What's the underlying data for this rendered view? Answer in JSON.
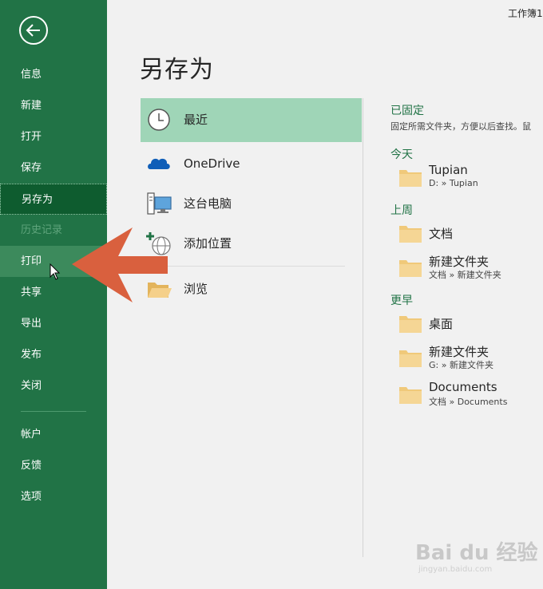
{
  "window": {
    "title": "工作簿1"
  },
  "sidebar": {
    "items": [
      {
        "label": "信息"
      },
      {
        "label": "新建"
      },
      {
        "label": "打开"
      },
      {
        "label": "保存"
      },
      {
        "label": "另存为"
      },
      {
        "label": "历史记录"
      },
      {
        "label": "打印"
      },
      {
        "label": "共享"
      },
      {
        "label": "导出"
      },
      {
        "label": "发布"
      },
      {
        "label": "关闭"
      },
      {
        "label": "帐户"
      },
      {
        "label": "反馈"
      },
      {
        "label": "选项"
      }
    ],
    "active": "另存为",
    "hovered": "打印",
    "disabled": "历史记录"
  },
  "main": {
    "title": "另存为",
    "locations": [
      {
        "label": "最近",
        "icon": "clock-icon"
      },
      {
        "label": "OneDrive",
        "icon": "cloud-icon"
      },
      {
        "label": "这台电脑",
        "icon": "computer-icon"
      },
      {
        "label": "添加位置",
        "icon": "add-globe-icon"
      },
      {
        "label": "浏览",
        "icon": "open-folder-icon"
      }
    ]
  },
  "recent": {
    "pinned": {
      "heading": "已固定",
      "description": "固定所需文件夹，方便以后查找。鼠"
    },
    "groups": [
      {
        "heading": "今天",
        "folders": [
          {
            "name": "Tupian",
            "path": "D: » Tupian"
          }
        ]
      },
      {
        "heading": "上周",
        "folders": [
          {
            "name": "文档",
            "path": ""
          },
          {
            "name": "新建文件夹",
            "path": "文档 » 新建文件夹"
          }
        ]
      },
      {
        "heading": "更早",
        "folders": [
          {
            "name": "桌面",
            "path": ""
          },
          {
            "name": "新建文件夹",
            "path": "G: » 新建文件夹"
          },
          {
            "name": "Documents",
            "path": "文档 » Documents"
          }
        ]
      }
    ]
  },
  "watermark": {
    "text": "Bai du 经验",
    "sub": "jingyan.baidu.com"
  },
  "colors": {
    "accent": "#217346",
    "selected": "#9fd5b7",
    "arrow": "#d9603e",
    "folder": "#f0c97a"
  }
}
